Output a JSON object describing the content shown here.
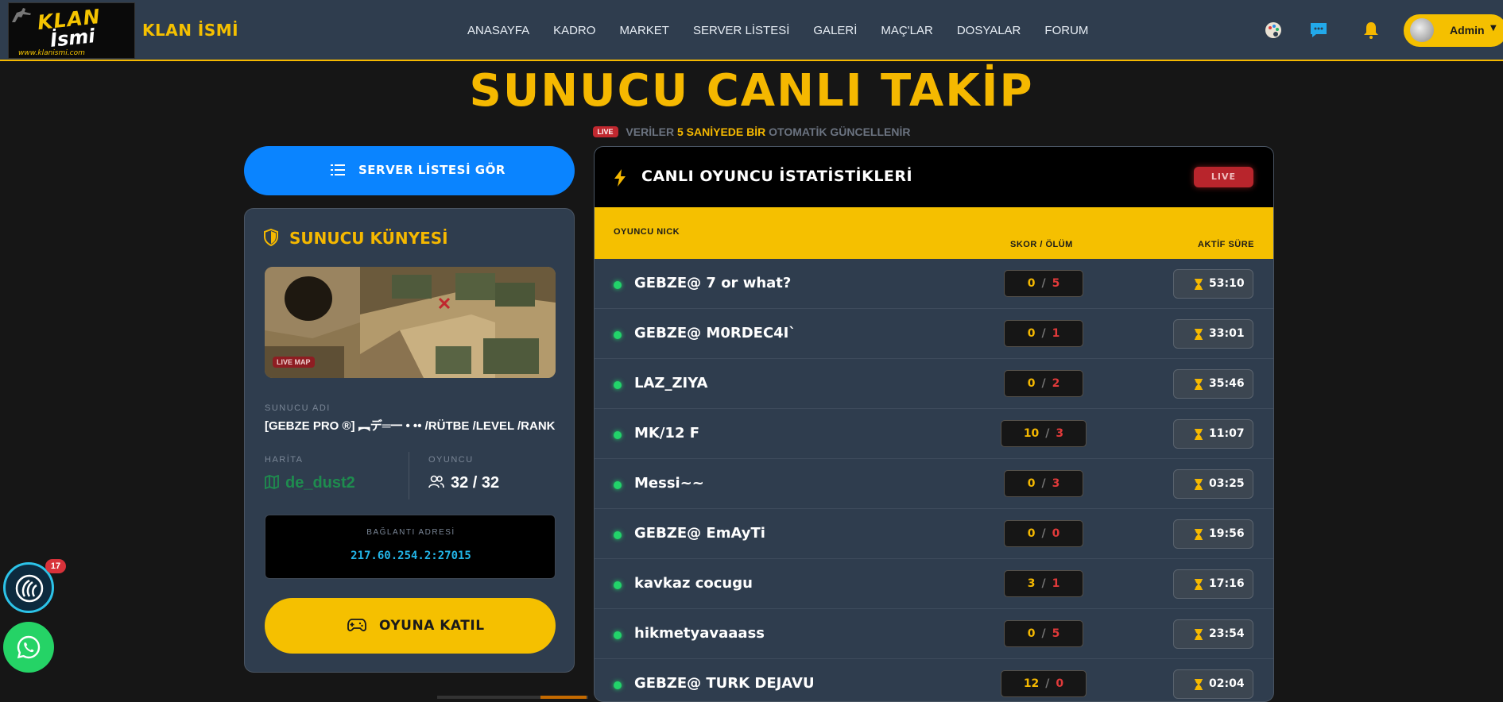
{
  "nav": {
    "logo_line1": "KLAN",
    "logo_line2": "İsmi",
    "logo_url": "www.klanismi.com",
    "brand": "KLAN İSMİ",
    "menu": [
      "ANASAYFA",
      "KADRO",
      "MARKET",
      "SERVER LİSTESİ",
      "GALERİ",
      "MAÇ'LAR",
      "DOSYALAR",
      "FORUM"
    ],
    "icons": [
      "palette-icon",
      "chat-icon",
      "bell-icon"
    ],
    "user": "Admin"
  },
  "hero": {
    "title": "SUNUCU CANLI TAKİP",
    "live_badge": "LIVE",
    "sub_prefix": "VERİLER",
    "sub_highlight": "5 SANİYEDE BİR",
    "sub_suffix": "OTOMATİK GÜNCELLENİR"
  },
  "left": {
    "server_list_button": "SERVER LİSTESİ GÖR",
    "card_title": "SUNUCU KÜNYESİ",
    "map_badge": "LIVE MAP",
    "server_name_label": "SUNUCU ADI",
    "server_name": "[GEBZE PRO ®] ︻デ═一 • •• /RÜTBE /LEVEL /RANK",
    "map_label": "HARİTA",
    "map": "de_dust2",
    "players_label": "OYUNCU",
    "players": "32 / 32",
    "address_label": "BAĞLANTI ADRESİ",
    "address": "217.60.254.2:27015",
    "join_button": "OYUNA KATIL"
  },
  "table": {
    "title": "CANLI OYUNCU İSTATİSTİKLERİ",
    "live_badge": "LIVE",
    "columns": [
      "OYUNCU NICK",
      "SKOR / ÖLÜM",
      "AKTİF SÜRE"
    ],
    "separator": "/",
    "rows": [
      {
        "nick": "GEBZE@ 7 or what?",
        "score": "0",
        "deaths": "5",
        "time": "53:10"
      },
      {
        "nick": "GEBZE@ M0RDEC4I`",
        "score": "0",
        "deaths": "1",
        "time": "33:01"
      },
      {
        "nick": "LAZ_ZIYA",
        "score": "0",
        "deaths": "2",
        "time": "35:46"
      },
      {
        "nick": "MK/12 F",
        "score": "10",
        "deaths": "3",
        "time": "11:07"
      },
      {
        "nick": "Messi~~",
        "score": "0",
        "deaths": "3",
        "time": "03:25"
      },
      {
        "nick": "GEBZE@ EmAyTi",
        "score": "0",
        "deaths": "0",
        "time": "19:56"
      },
      {
        "nick": "kavkaz cocugu",
        "score": "3",
        "deaths": "1",
        "time": "17:16"
      },
      {
        "nick": "hikmetyavaaass",
        "score": "0",
        "deaths": "5",
        "time": "23:54"
      },
      {
        "nick": "GEBZE@ TURK DEJAVU",
        "score": "12",
        "deaths": "0",
        "time": "02:04"
      }
    ]
  },
  "floating": {
    "notification_count": "17"
  },
  "colors": {
    "accent": "#f5b800",
    "nav_bg": "#2f3d4e",
    "page_bg": "#161616",
    "blue_button": "#0a84ff",
    "live_red": "#b8252c",
    "online_green": "#22d46a",
    "whatsapp": "#25d366"
  }
}
